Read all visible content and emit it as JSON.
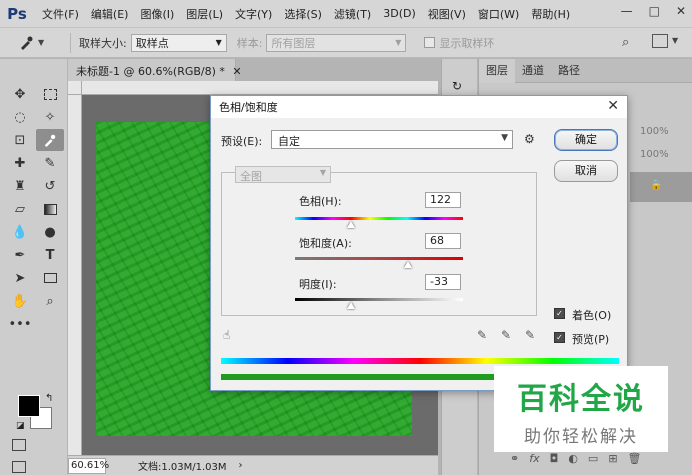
{
  "menubar": {
    "logo": "Ps",
    "items": [
      "文件(F)",
      "编辑(E)",
      "图像(I)",
      "图层(L)",
      "文字(Y)",
      "选择(S)",
      "滤镜(T)",
      "3D(D)",
      "视图(V)",
      "窗口(W)",
      "帮助(H)"
    ],
    "window_controls": [
      "—",
      "□",
      "✕"
    ]
  },
  "optbar": {
    "sample_size_label": "取样大小:",
    "sample_size_value": "取样点",
    "sample_label": "样本:",
    "sample_value": "所有图层",
    "show_ring_label": "显示取样环"
  },
  "document": {
    "tab_title": "未标题-1 @ 60.6%(RGB/8) *",
    "zoom": "60.61%",
    "doc_info": "文档:1.03M/1.03M",
    "canvas_color": "#1fa31f"
  },
  "panels": {
    "tabs": [
      "图层",
      "通道",
      "路径"
    ],
    "opacity": "100%",
    "fill": "100%"
  },
  "dialog": {
    "title": "色相/饱和度",
    "preset_label": "预设(E):",
    "preset_value": "自定",
    "channel_value": "全图",
    "ok_label": "确定",
    "cancel_label": "取消",
    "hue_label": "色相(H):",
    "hue_value": "122",
    "saturation_label": "饱和度(A):",
    "saturation_value": "68",
    "lightness_label": "明度(I):",
    "lightness_value": "-33",
    "colorize_label": "着色(O)",
    "colorize_checked": true,
    "preview_label": "预览(P)",
    "preview_checked": true
  },
  "watermark": {
    "main": "百科全说",
    "sub": "助你轻松解决"
  }
}
